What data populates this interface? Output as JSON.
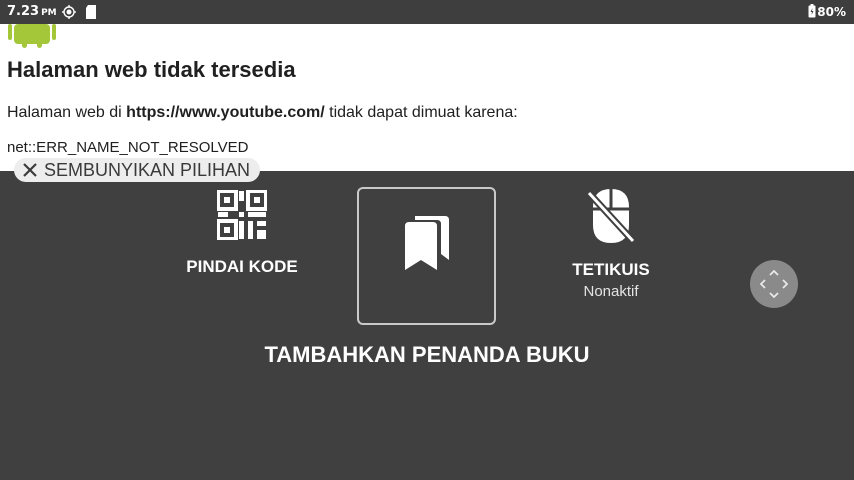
{
  "status_bar": {
    "time": "7.23",
    "ampm": "PM",
    "battery": "80%"
  },
  "page": {
    "title": "Halaman web tidak tersedia",
    "message_prefix": "Halaman web di ",
    "url": "https://www.youtube.com/",
    "message_suffix": " tidak dapat dimuat karena:",
    "error_code": "net::ERR_NAME_NOT_RESOLVED"
  },
  "overlay": {
    "hide_options_label": "SEMBUNYIKAN PILIHAN",
    "scan_code_label": "PINDAI KODE",
    "mouse_label": "TETIKUIS",
    "mouse_status": "Nonaktif",
    "add_bookmark_label": "TAMBAHKAN PENANDA BUKU"
  },
  "icons": {
    "status": [
      "gps-icon",
      "sd-card-icon",
      "battery-icon"
    ],
    "options": [
      "close-icon",
      "qr-code-icon",
      "bookmark-icon",
      "mouse-off-icon",
      "dpad-icon"
    ]
  },
  "colors": {
    "status_bar": "#3e3e3e",
    "overlay": "#404040",
    "android_green": "#a4c639",
    "chip": "#ededed"
  }
}
